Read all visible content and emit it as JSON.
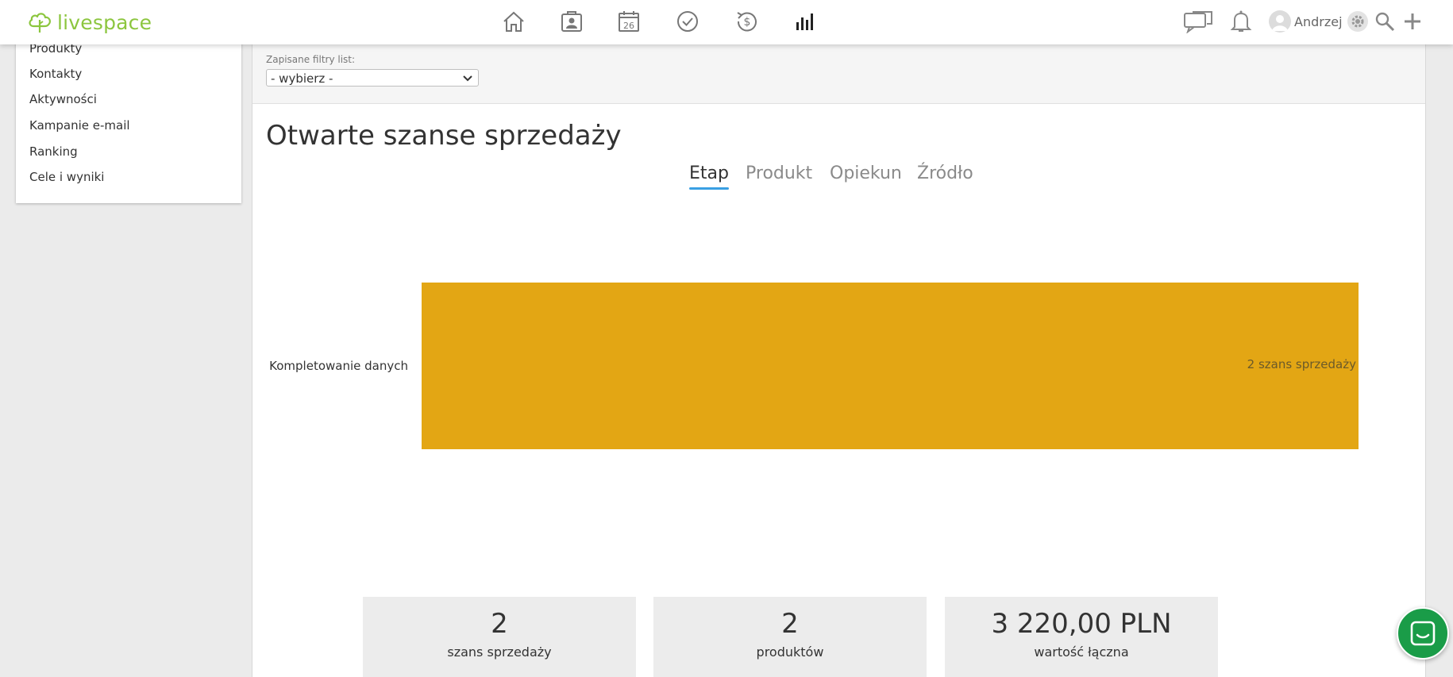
{
  "app": {
    "logo_text": "livespace",
    "brand_color": "#8cc63f"
  },
  "topnav": {
    "icons": [
      "home-icon",
      "contacts-icon",
      "calendar-icon",
      "tasks-icon",
      "deals-icon",
      "reports-icon"
    ],
    "calendar_day": "26",
    "active_icon": "reports-icon"
  },
  "header_right": {
    "user_name": "Andrzej",
    "icons": [
      "chat-icon",
      "bell-icon",
      "avatar",
      "gear-icon",
      "search-icon",
      "plus-icon"
    ]
  },
  "sidebar": {
    "items": [
      {
        "label": "Produkty"
      },
      {
        "label": "Kontakty"
      },
      {
        "label": "Aktywności"
      },
      {
        "label": "Kampanie e-mail"
      },
      {
        "label": "Ranking"
      },
      {
        "label": "Cele i wyniki"
      }
    ]
  },
  "filters": {
    "label": "Zapisane filtry list:",
    "selected": "- wybierz -"
  },
  "page": {
    "title": "Otwarte szanse sprzedaży"
  },
  "tabs": [
    {
      "label": "Etap",
      "active": true
    },
    {
      "label": "Produkt",
      "active": false
    },
    {
      "label": "Opiekun",
      "active": false
    },
    {
      "label": "Źródło",
      "active": false
    }
  ],
  "chart_data": {
    "type": "bar",
    "orientation": "horizontal",
    "categories": [
      "Kompletowanie danych"
    ],
    "values": [
      2
    ],
    "data_labels": [
      "2 szans sprzedaży"
    ],
    "bar_color": "#e3a614",
    "xlim": [
      0,
      2
    ]
  },
  "stats": [
    {
      "value": "2",
      "label": "szans sprzedaży"
    },
    {
      "value": "2",
      "label": "produktów"
    },
    {
      "value": "3 220,00 PLN",
      "label": "wartość łączna"
    }
  ],
  "colors": {
    "tab_underline": "#3aa0e3",
    "chat_button": "#1a9c48"
  }
}
